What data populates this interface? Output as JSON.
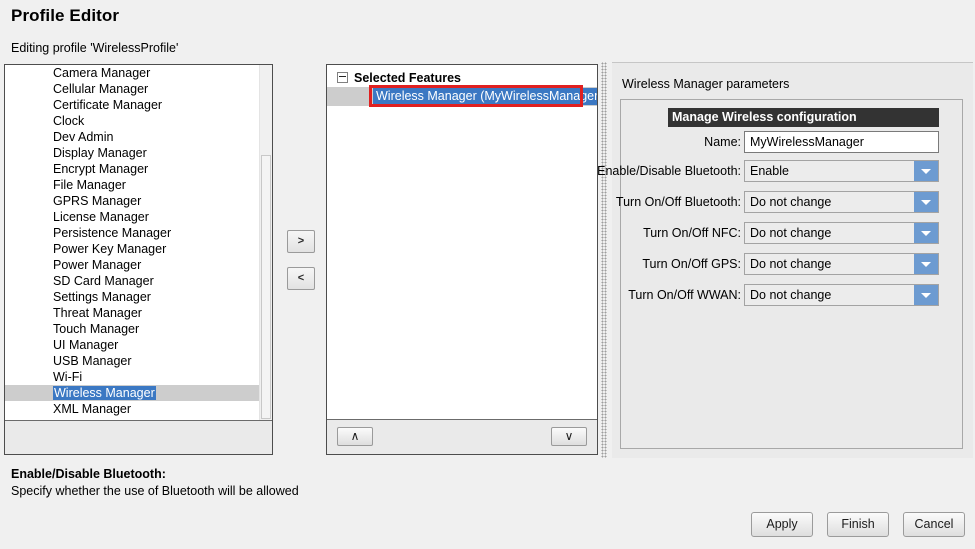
{
  "header": {
    "title": "Profile Editor",
    "subtitle": "Editing profile 'WirelessProfile'"
  },
  "available_features": {
    "items": [
      "Camera Manager",
      "Cellular Manager",
      "Certificate Manager",
      "Clock",
      "Dev Admin",
      "Display Manager",
      "Encrypt Manager",
      "File Manager",
      "GPRS Manager",
      "License Manager",
      "Persistence Manager",
      "Power Key Manager",
      "Power Manager",
      "SD Card Manager",
      "Settings Manager",
      "Threat Manager",
      "Touch Manager",
      "UI Manager",
      "USB Manager",
      "Wi-Fi",
      "Wireless Manager",
      "XML Manager"
    ],
    "selected_item": "Wireless Manager",
    "selection_color": "#3b78c3",
    "row_band_color": "#cdcdcd"
  },
  "transfer_buttons": {
    "add_label": ">",
    "remove_label": "<"
  },
  "selected_features": {
    "root_label": "Selected Features",
    "toggle_icon": "collapse-minus-icon",
    "children": [
      "Wireless Manager (MyWirelessManager)"
    ],
    "selected_child": "Wireless Manager (MyWirelessManager)",
    "annotation_color": "#e02020",
    "move_up_label": "∧",
    "move_down_label": "∨"
  },
  "parameters_panel": {
    "title": "Wireless Manager parameters",
    "group_header": "Manage Wireless configuration",
    "header_bg": "#333333",
    "combo_accent": "#6d9bd1",
    "fields": [
      {
        "label": "Name:",
        "type": "text",
        "value": "MyWirelessManager",
        "placeholder": ""
      },
      {
        "label": "Enable/Disable Bluetooth:",
        "type": "combo",
        "value": "Enable"
      },
      {
        "label": "Turn On/Off Bluetooth:",
        "type": "combo",
        "value": "Do not change"
      },
      {
        "label": "Turn On/Off NFC:",
        "type": "combo",
        "value": "Do not change"
      },
      {
        "label": "Turn On/Off GPS:",
        "type": "combo",
        "value": "Do not change"
      },
      {
        "label": "Turn On/Off WWAN:",
        "type": "combo",
        "value": "Do not change"
      }
    ]
  },
  "help": {
    "title": "Enable/Disable Bluetooth:",
    "body": "Specify whether the use of Bluetooth will be allowed"
  },
  "footer": {
    "apply_label": "Apply",
    "finish_label": "Finish",
    "cancel_label": "Cancel"
  }
}
